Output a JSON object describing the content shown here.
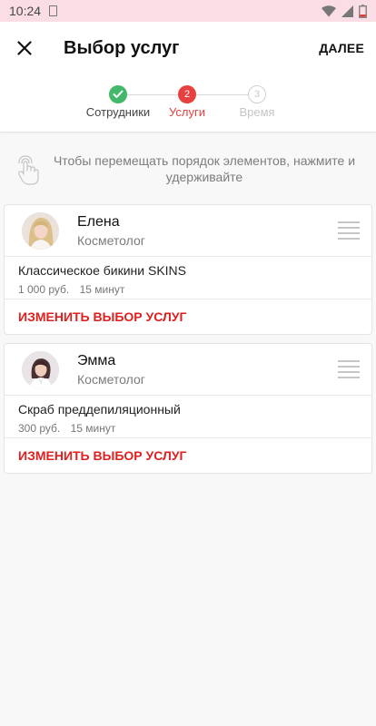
{
  "status_bar": {
    "time": "10:24"
  },
  "app_bar": {
    "title": "Выбор услуг",
    "next_label": "ДАЛЕЕ"
  },
  "stepper": {
    "steps": [
      {
        "label": "Сотрудники",
        "state": "done",
        "number": ""
      },
      {
        "label": "Услуги",
        "state": "active",
        "number": "2"
      },
      {
        "label": "Время",
        "state": "todo",
        "number": "3"
      }
    ]
  },
  "hint": {
    "text": "Чтобы перемещать порядок элементов, нажмите и удерживайте",
    "icon": "touch-hold-icon"
  },
  "employees": [
    {
      "name": "Елена",
      "role": "Косметолог",
      "service": {
        "name": "Классическое бикини SKINS",
        "price": "1 000 руб.",
        "duration": "15 минут"
      },
      "change_label": "ИЗМЕНИТЬ ВЫБОР УСЛУГ"
    },
    {
      "name": "Эмма",
      "role": "Косметолог",
      "service": {
        "name": "Скраб преддепиляционный",
        "price": "300 руб.",
        "duration": "15 минут"
      },
      "change_label": "ИЗМЕНИТЬ ВЫБОР УСЛУГ"
    }
  ],
  "colors": {
    "accent": "#e0201f",
    "done": "#43b86a",
    "status_bar": "#fbdde6"
  }
}
